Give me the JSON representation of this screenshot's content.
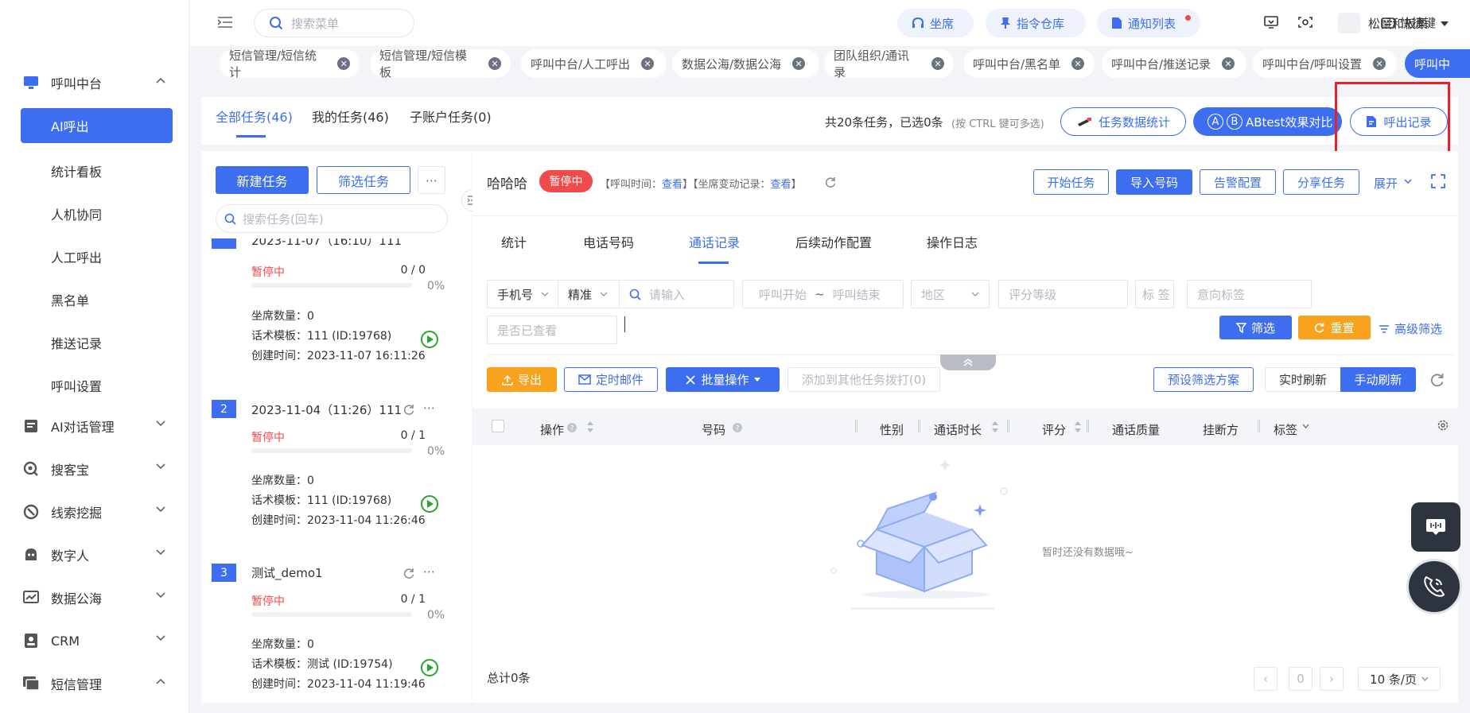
{
  "sidebar": {
    "groups": [
      {
        "label": "呼叫中台",
        "icon": "monitor-icon"
      },
      {
        "label": "AI对话管理",
        "icon": "chat-icon"
      },
      {
        "label": "搜客宝",
        "icon": "search-customer-icon"
      },
      {
        "label": "线索挖掘",
        "icon": "clue-icon"
      },
      {
        "label": "数字人",
        "icon": "robot-icon"
      },
      {
        "label": "数据公海",
        "icon": "chart-icon"
      },
      {
        "label": "CRM",
        "icon": "contacts-icon"
      },
      {
        "label": "短信管理",
        "icon": "sms-icon"
      }
    ],
    "sub_items": [
      "AI呼出",
      "统计看板",
      "人机协同",
      "人工呼出",
      "黑名单",
      "推送记录",
      "呼叫设置"
    ]
  },
  "topbar": {
    "search_placeholder": "搜索菜单",
    "pills": [
      "坐席",
      "指令仓库",
      "通知列表"
    ],
    "shortcut": "快捷键",
    "user": "松鼠和板栗"
  },
  "tabs": [
    "短信管理/短信统计",
    "短信管理/短信模板",
    "呼叫中台/人工呼出",
    "数据公海/数据公海",
    "团队组织/通讯录",
    "呼叫中台/黑名单",
    "呼叫中台/推送记录",
    "呼叫中台/呼叫设置",
    "呼叫中"
  ],
  "header": {
    "task_tabs": [
      "全部任务(46)",
      "我的任务(46)",
      "子账户任务(0)"
    ],
    "summary": "共20条任务，已选0条",
    "hint": "(按 CTRL 键可多选)",
    "stats_button": "任务数据统计",
    "ab_button": "ABtest效果对比",
    "ab_badge_a": "A",
    "ab_badge_b": "B",
    "call_records_button": "呼出记录"
  },
  "task_panel": {
    "new_task": "新建任务",
    "filter_task": "筛选任务",
    "search_placeholder": "搜索任务(回车)",
    "partial_title": "2023-11-07（16:10）111",
    "labels": {
      "seats": "坐席数量：",
      "script": "话术模板：",
      "created": "创建时间："
    },
    "tasks": [
      {
        "index": "",
        "title": "",
        "status": "暂停中",
        "count": "0 / 0",
        "percent": "0%",
        "seats": "0",
        "script": "111 (ID:19768)",
        "created": "2023-11-07 16:11:26"
      },
      {
        "index": "2",
        "title": "2023-11-04（11:26）111",
        "status": "暂停中",
        "count": "0 / 1",
        "percent": "0%",
        "seats": "0",
        "script": "111 (ID:19768)",
        "created": "2023-11-04 11:26:46"
      },
      {
        "index": "3",
        "title": "测试_demo1",
        "status": "暂停中",
        "count": "0 / 1",
        "percent": "0%",
        "seats": "0",
        "script": "测试 (ID:19754)",
        "created": "2023-11-04 11:19:46"
      }
    ]
  },
  "detail": {
    "name": "哈哈哈",
    "status": "暂停中",
    "call_time_label": "【呼叫时间：",
    "view1": "查看",
    "seat_change_label": "】【坐席变动记录：",
    "view2": "查看",
    "bracket_end": "】",
    "buttons": [
      "开始任务",
      "导入号码",
      "告警配置",
      "分享任务"
    ],
    "expand": "展开",
    "subtabs": [
      "统计",
      "电话号码",
      "通话记录",
      "后续动作配置",
      "操作日志"
    ],
    "filters": {
      "phone_select": "手机号",
      "match_select": "精准",
      "input_placeholder": "请输入",
      "call_start": "呼叫开始",
      "tilde": "~",
      "call_end": "呼叫结束",
      "region": "地区",
      "score_level": "评分等级",
      "tag": "标 签",
      "intent_tag": "意向标签",
      "viewed": "是否已查看",
      "filter_btn": "筛选",
      "reset_btn": "重置",
      "advanced": "高级筛选"
    },
    "actions": {
      "export": "导出",
      "scheduled_mail": "定时邮件",
      "batch": "批量操作",
      "add_to_other": "添加到其他任务拨打(0)",
      "preset": "预设筛选方案",
      "realtime": "实时刷新",
      "manual": "手动刷新"
    },
    "columns": [
      "操作",
      "号码",
      "性别",
      "通话时长",
      "评分",
      "通话质量",
      "挂断方",
      "标签"
    ],
    "empty_text": "暂时还没有数据哦~",
    "total": "总计0条",
    "page": "0",
    "page_size": "10 条/页"
  },
  "colors": {
    "primary": "#3d6ef0",
    "danger": "#f04a4a",
    "warning": "#f9a21d",
    "highlight": "#e8202a",
    "success": "#2aa52f"
  }
}
